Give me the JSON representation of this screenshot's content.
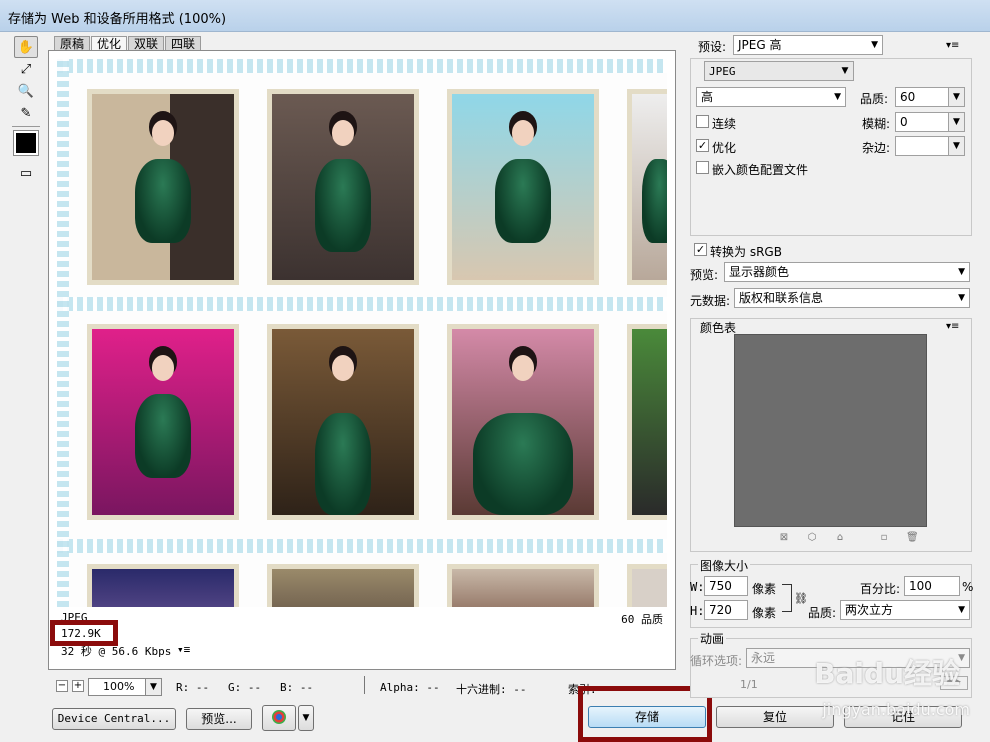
{
  "window": {
    "title": "存储为 Web 和设备所用格式 (100%)"
  },
  "tools": [
    "hand-tool-icon",
    "slice-select-icon",
    "zoom-icon",
    "eyedropper-icon"
  ],
  "tabs": [
    {
      "label": "原稿",
      "active": false
    },
    {
      "label": "优化",
      "active": true
    },
    {
      "label": "双联",
      "active": false
    },
    {
      "label": "四联",
      "active": false
    }
  ],
  "preview_info": {
    "format": "JPEG",
    "size": "172.9K",
    "time": "32 秒 @ 56.6 Kbps",
    "quality": "60 品质"
  },
  "status": {
    "zoom": "100%",
    "r": "R: --",
    "g": "G: --",
    "b": "B: --",
    "alpha": "Alpha: --",
    "hex": "十六进制: --",
    "index": "索引: --"
  },
  "buttons": {
    "device_central": "Device Central...",
    "preview": "预览...",
    "save": "存储",
    "reset": "复位",
    "remember": "记住"
  },
  "settings": {
    "preset_label": "预设:",
    "preset_value": "JPEG 高",
    "format_value": "JPEG",
    "quality_preset": "高",
    "quality_label": "品质:",
    "quality_value": "60",
    "progressive_label": "连续",
    "progressive_checked": false,
    "blur_label": "模糊:",
    "blur_value": "0",
    "optimized_label": "优化",
    "optimized_checked": true,
    "matte_label": "杂边:",
    "embed_profile_label": "嵌入颜色配置文件",
    "embed_profile_checked": false,
    "convert_srgb_label": "转换为 sRGB",
    "convert_srgb_checked": true,
    "preview_label": "预览:",
    "preview_value": "显示器颜色",
    "metadata_label": "元数据:",
    "metadata_value": "版权和联系信息"
  },
  "color_table": {
    "title": "颜色表"
  },
  "image_size": {
    "title": "图像大小",
    "w_label": "W:",
    "w_value": "750",
    "h_label": "H:",
    "h_value": "720",
    "unit": "像素",
    "percent_label": "百分比:",
    "percent_value": "100",
    "percent_sign": "%",
    "quality_label": "品质:",
    "quality_value": "两次立方"
  },
  "animation": {
    "title": "动画",
    "loop_label": "循环选项:",
    "loop_value": "永远",
    "frame": "1/1"
  },
  "watermark": {
    "text": "Baidu经验",
    "sub": "jingyan.baidu.com"
  },
  "colors": {
    "highlight_box": "#8b0b0b",
    "dress": "#0f4a30",
    "color_table_bg": "#6d6d6d"
  }
}
